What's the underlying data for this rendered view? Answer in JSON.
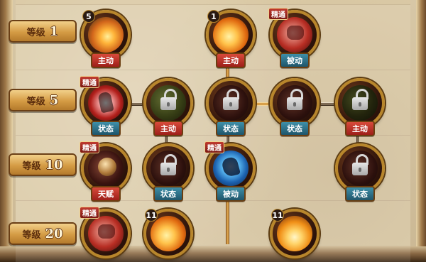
{
  "levels": [
    {
      "label": "等级",
      "value": "1"
    },
    {
      "label": "等级",
      "value": "5"
    },
    {
      "label": "等级",
      "value": "10"
    },
    {
      "label": "等级",
      "value": "20"
    }
  ],
  "skill_nodes": [
    {
      "id": "r1c1",
      "badge": "主动",
      "badge_color": "red",
      "count": "5",
      "tag": "",
      "locked": false,
      "icon": "flame-swirl-icon"
    },
    {
      "id": "r1c2",
      "badge": "主动",
      "badge_color": "red",
      "count": "1",
      "tag": "",
      "locked": false,
      "icon": "flame-swirl-icon"
    },
    {
      "id": "r1c3",
      "badge": "被动",
      "badge_color": "blue",
      "count": "",
      "tag": "精通",
      "locked": false,
      "icon": "fist-icon"
    },
    {
      "id": "r2c1",
      "badge": "状态",
      "badge_color": "blue",
      "count": "",
      "tag": "精通",
      "locked": false,
      "icon": "spirit-silhouette-icon"
    },
    {
      "id": "r2c2",
      "badge": "主动",
      "badge_color": "red",
      "count": "",
      "tag": "",
      "locked": true,
      "icon": "locked-skill-icon"
    },
    {
      "id": "r2c3",
      "badge": "状态",
      "badge_color": "blue",
      "count": "",
      "tag": "",
      "locked": true,
      "icon": "locked-skill-icon"
    },
    {
      "id": "r2c4",
      "badge": "状态",
      "badge_color": "blue",
      "count": "",
      "tag": "",
      "locked": true,
      "icon": "locked-skill-icon"
    },
    {
      "id": "r2c5",
      "badge": "主动",
      "badge_color": "red",
      "count": "",
      "tag": "",
      "locked": true,
      "icon": "locked-skill-icon"
    },
    {
      "id": "r3c1",
      "badge": "天赋",
      "badge_color": "red",
      "count": "",
      "tag": "精通",
      "locked": false,
      "icon": "warrior-face-icon"
    },
    {
      "id": "r3c2",
      "badge": "状态",
      "badge_color": "blue",
      "count": "",
      "tag": "",
      "locked": true,
      "icon": "locked-skill-icon"
    },
    {
      "id": "r3c3",
      "badge": "被动",
      "badge_color": "blue",
      "count": "",
      "tag": "精通",
      "locked": false,
      "icon": "foot-icon"
    },
    {
      "id": "r3c5",
      "badge": "状态",
      "badge_color": "blue",
      "count": "",
      "tag": "",
      "locked": true,
      "icon": "locked-skill-icon"
    },
    {
      "id": "r4c1",
      "badge": "",
      "badge_color": "red",
      "count": "",
      "tag": "精通",
      "locked": false,
      "icon": "fist-icon"
    },
    {
      "id": "r4c2",
      "badge": "",
      "badge_color": "red",
      "count": "11",
      "tag": "",
      "locked": false,
      "icon": "flame-icon"
    },
    {
      "id": "r4c4",
      "badge": "",
      "badge_color": "red",
      "count": "11",
      "tag": "",
      "locked": false,
      "icon": "flame-icon"
    }
  ]
}
